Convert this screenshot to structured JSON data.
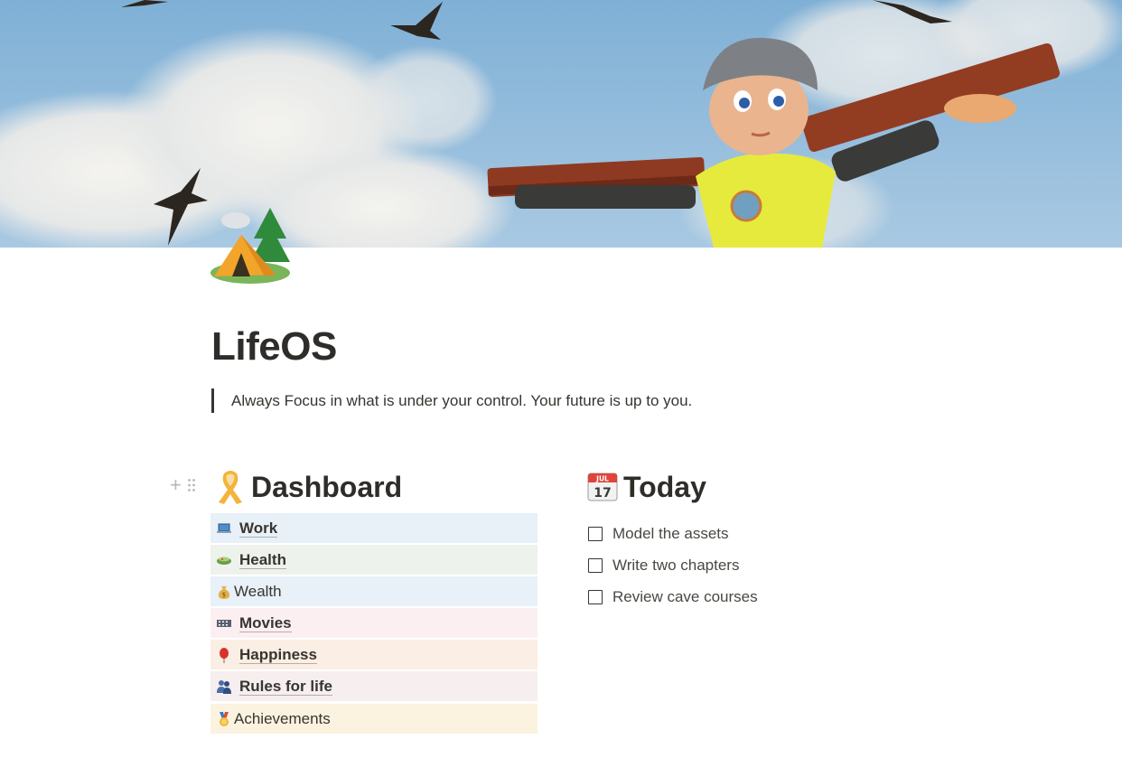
{
  "page": {
    "title": "LifeOS",
    "quote": "Always Focus in what is under your control. Your future is up to you."
  },
  "cover": {
    "description_icon": "cover-image"
  },
  "page_icon": "camping-tent-icon",
  "dashboard": {
    "heading": "Dashboard",
    "icon": "ribbon-icon",
    "items": [
      {
        "label": "Work",
        "icon": "laptop-icon",
        "color": "#e8f1f8",
        "linked": true
      },
      {
        "label": "Health",
        "icon": "salad-icon",
        "color": "#edf2ec",
        "linked": true
      },
      {
        "label": "Wealth",
        "icon": "money-bag-icon",
        "color": "#e8f1f8",
        "linked": false
      },
      {
        "label": "Movies",
        "icon": "film-icon",
        "color": "#fbeff2",
        "linked": true
      },
      {
        "label": "Happiness",
        "icon": "balloon-icon",
        "color": "#fbeee4",
        "linked": true
      },
      {
        "label": "Rules for life",
        "icon": "people-icon",
        "color": "#f6eeef",
        "linked": true
      },
      {
        "label": "Achievements",
        "icon": "medal-icon",
        "color": "#fbf3e0",
        "linked": false
      }
    ]
  },
  "today": {
    "heading": "Today",
    "icon": "calendar-icon",
    "calendar_month": "JUL",
    "calendar_day": "17",
    "todos": [
      {
        "label": "Model the assets",
        "checked": false
      },
      {
        "label": "Write two chapters",
        "checked": false
      },
      {
        "label": "Review cave courses",
        "checked": false
      }
    ]
  },
  "block_handle": {
    "plus": "+"
  }
}
